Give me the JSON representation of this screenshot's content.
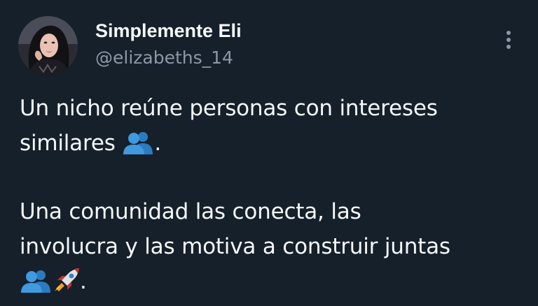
{
  "tweet": {
    "display_name": "Simplemente Eli",
    "handle": "@elizabeths_14",
    "lines": [
      "Un nicho reúne personas con intereses",
      "similares",
      ".",
      "Una comunidad las conecta, las",
      "involucra y las motiva a construir juntas",
      "."
    ]
  },
  "icons": {
    "more": "vertical-ellipsis-icon",
    "emoji_people": "busts-in-silhouette-icon",
    "emoji_rocket": "rocket-icon"
  },
  "colors": {
    "background": "#15202b",
    "text": "#f7f9f9",
    "secondary": "#8b98a5",
    "emoji_people": "#3f9ae0"
  }
}
